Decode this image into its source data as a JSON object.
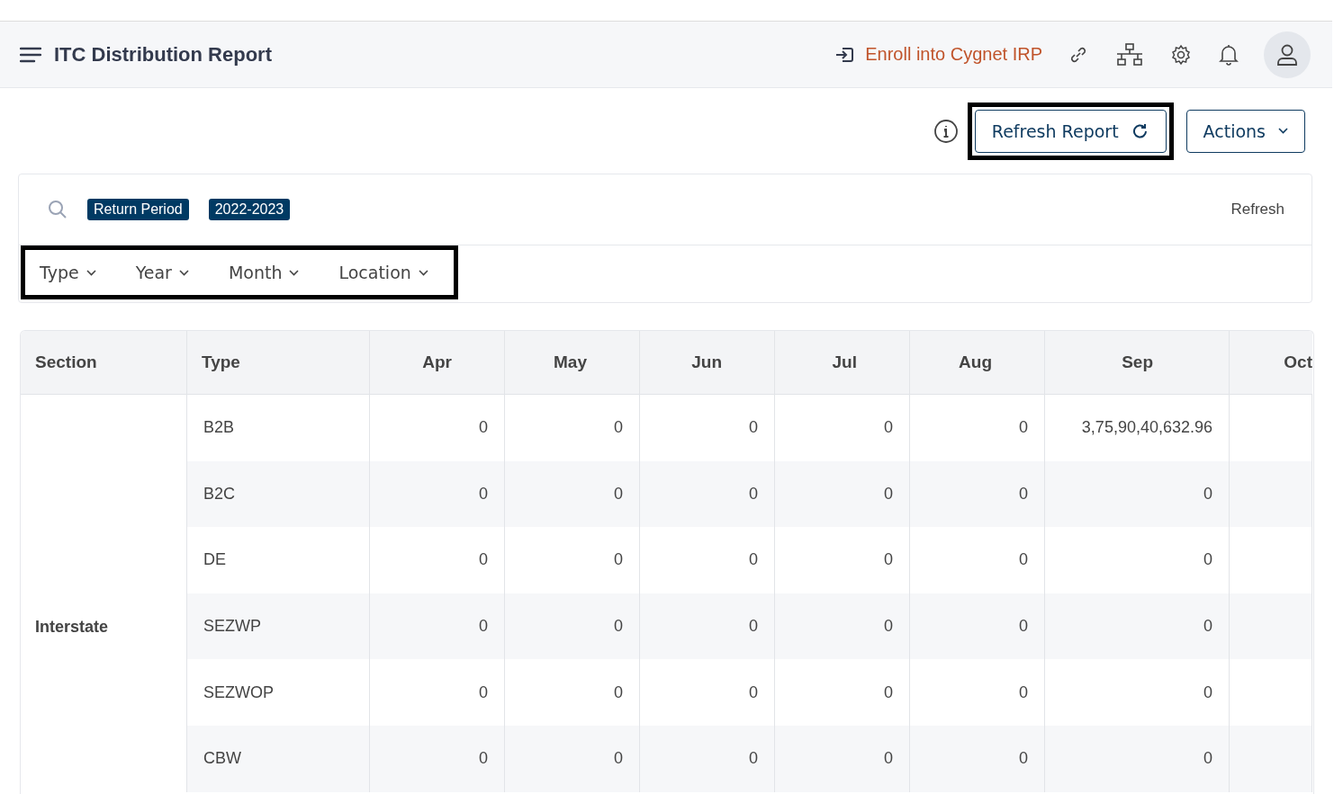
{
  "header": {
    "title": "ITC Distribution Report",
    "enroll_link": "Enroll into Cygnet IRP"
  },
  "toolbar": {
    "buttons": [
      {
        "label": "Refresh Report",
        "kind": "refresh",
        "highlighted": true
      },
      {
        "label": "Actions",
        "kind": "dropdown",
        "highlighted": false
      }
    ]
  },
  "filters": {
    "chips": [
      "Return Period",
      "2022-2023"
    ],
    "refresh_link": "Refresh",
    "highlighted": true,
    "dropdowns": [
      "Type",
      "Year",
      "Month",
      "Location"
    ]
  },
  "table": {
    "columns": [
      "Section",
      "Type",
      "Apr",
      "May",
      "Jun",
      "Jul",
      "Aug",
      "Sep",
      "Oct"
    ],
    "section": "Interstate",
    "rows": [
      {
        "type": "B2B",
        "values": [
          "0",
          "0",
          "0",
          "0",
          "0",
          "3,75,90,40,632.96"
        ]
      },
      {
        "type": "B2C",
        "values": [
          "0",
          "0",
          "0",
          "0",
          "0",
          "0"
        ]
      },
      {
        "type": "DE",
        "values": [
          "0",
          "0",
          "0",
          "0",
          "0",
          "0"
        ]
      },
      {
        "type": "SEZWP",
        "values": [
          "0",
          "0",
          "0",
          "0",
          "0",
          "0"
        ]
      },
      {
        "type": "SEZWOP",
        "values": [
          "0",
          "0",
          "0",
          "0",
          "0",
          "0"
        ]
      },
      {
        "type": "CBW",
        "values": [
          "0",
          "0",
          "0",
          "0",
          "0",
          "0"
        ]
      }
    ]
  }
}
